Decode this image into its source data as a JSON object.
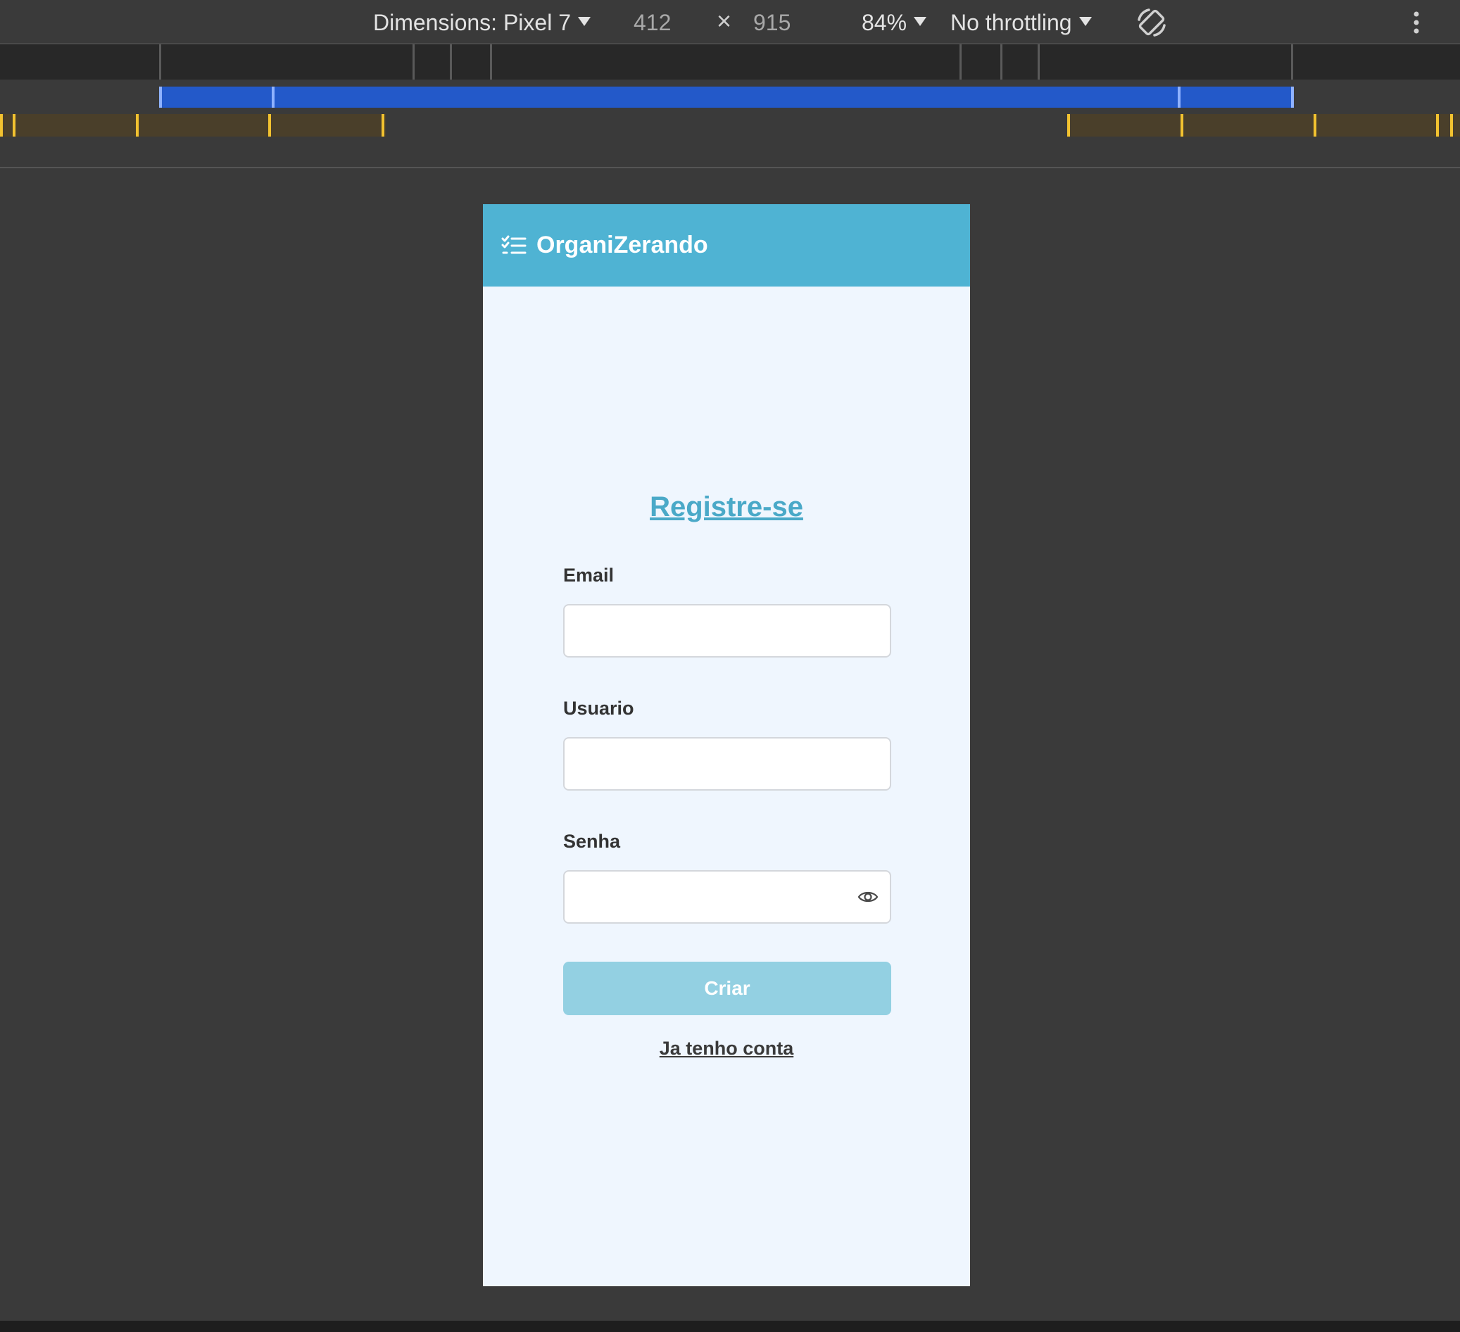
{
  "devtools": {
    "device_label": "Dimensions: Pixel 7",
    "width_value": "412",
    "times": "×",
    "height_value": "915",
    "zoom_label": "84%",
    "throttling_label": "No throttling",
    "rotate_icon": "rotate-icon",
    "more_icon": "more-vertical-icon"
  },
  "app": {
    "header_icon": "checklist-icon",
    "title": "OrganiZerando",
    "header_color": "#4fb3d3",
    "background_color": "#eff6fe"
  },
  "form": {
    "heading": "Registre-se",
    "email_label": "Email",
    "email_value": "",
    "username_label": "Usuario",
    "username_value": "",
    "password_label": "Senha",
    "password_value": "",
    "password_toggle_icon": "eye-icon",
    "submit_label": "Criar",
    "submit_color": "#93d0e2",
    "login_link": "Ja tenho conta"
  }
}
